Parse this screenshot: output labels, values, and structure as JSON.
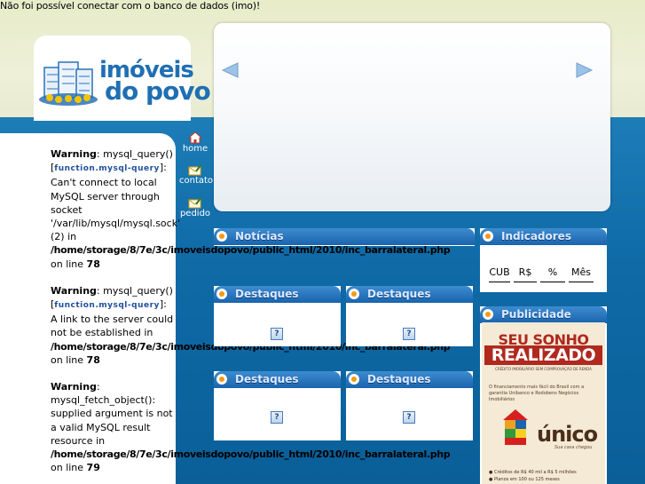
{
  "top_error": "Não foi possível conectar com o banco de dados (imo)!",
  "logo": {
    "line1": "imóveis",
    "line2": "do povo"
  },
  "nav": {
    "home": "home",
    "contato": "contato",
    "pedido": "pedido"
  },
  "warnings": [
    {
      "label": "Warning",
      "pre": ": mysql_query() [",
      "fn": "function.mysql-query",
      "post": "]: Can't connect to local MySQL server through socket '/var/lib/mysql/mysql.sock' (2) in",
      "path": "/home/storage/8/7e/3c/imoveisdopovo/public_html/2010/inc_barralateral.php",
      "line_pre": "on line ",
      "line": "78"
    },
    {
      "label": "Warning",
      "pre": ": mysql_query() [",
      "fn": "function.mysql-query",
      "post": "]: A link to the server could not be established in",
      "path": "/home/storage/8/7e/3c/imoveisdopovo/public_html/2010/inc_barralateral.php",
      "line_pre": "on line ",
      "line": "78"
    },
    {
      "label": "Warning",
      "pre": ": mysql_fetch_object(): supplied argument is not a valid MySQL result resource in",
      "path": "/home/storage/8/7e/3c/imoveisdopovo/public_html/2010/inc_barralateral.php",
      "line_pre": "on line ",
      "line": "79"
    }
  ],
  "boxes": {
    "noticias": "Notícias",
    "destaques": "Destaques",
    "indicadores": "Indicadores",
    "publicidade": "Publicidade"
  },
  "indicadores": {
    "cub": "CUB",
    "rs": "R$",
    "pct": "%",
    "mes": "Mês"
  },
  "ad": {
    "line1": "SEU SONHO",
    "line2": "REALIZADO",
    "line3": "CRÉDITO IMOBILIÁRIO SEM COMPROVAÇÃO DE RENDA",
    "body": "O financiamento mais fácil do Brasil com a garantia Unibanco e Rodobens Negócios Imobiliários",
    "brand": "único",
    "tagline": "Sua casa chegou",
    "bullet1": "Créditos de R$ 40 mil a R$ 5 milhões",
    "bullet2": "Planos em 100 ou 125 meses"
  },
  "broken_image_icon": "?",
  "colors": {
    "accent": "#1a64ad",
    "bullet": "#f29a16",
    "band": "#0f6aa6"
  }
}
